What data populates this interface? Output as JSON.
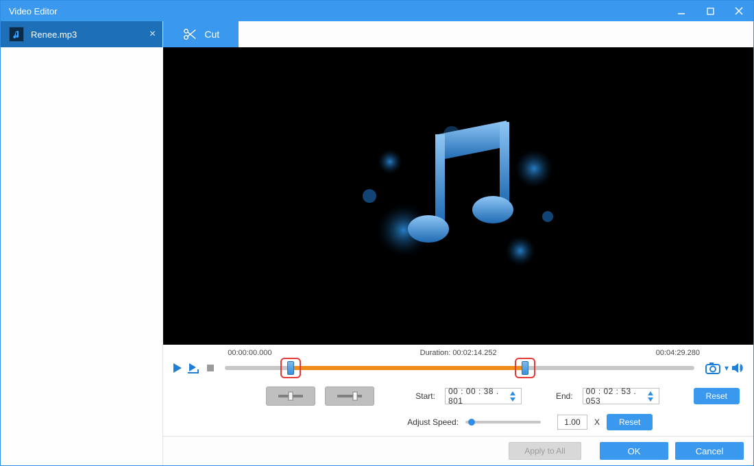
{
  "window": {
    "title": "Video Editor"
  },
  "sidebar": {
    "file_name": "Renee.mp3"
  },
  "toolbar": {
    "cut_label": "Cut"
  },
  "timeline": {
    "start_time": "00:00:00.000",
    "duration_label": "Duration: 00:02:14.252",
    "end_time": "00:04:29.280",
    "sel_start_pct": 14,
    "sel_end_pct": 64
  },
  "cut": {
    "start_label": "Start:",
    "start_value": "00 : 00 : 38 . 801",
    "end_label": "End:",
    "end_value": "00 : 02 : 53 . 053",
    "reset_label": "Reset"
  },
  "speed": {
    "label": "Adjust Speed:",
    "value": "1.00",
    "unit": "X",
    "reset_label": "Reset",
    "thumb_pct": 8
  },
  "footer": {
    "apply_all": "Apply to All",
    "ok": "OK",
    "cancel": "Cancel"
  }
}
